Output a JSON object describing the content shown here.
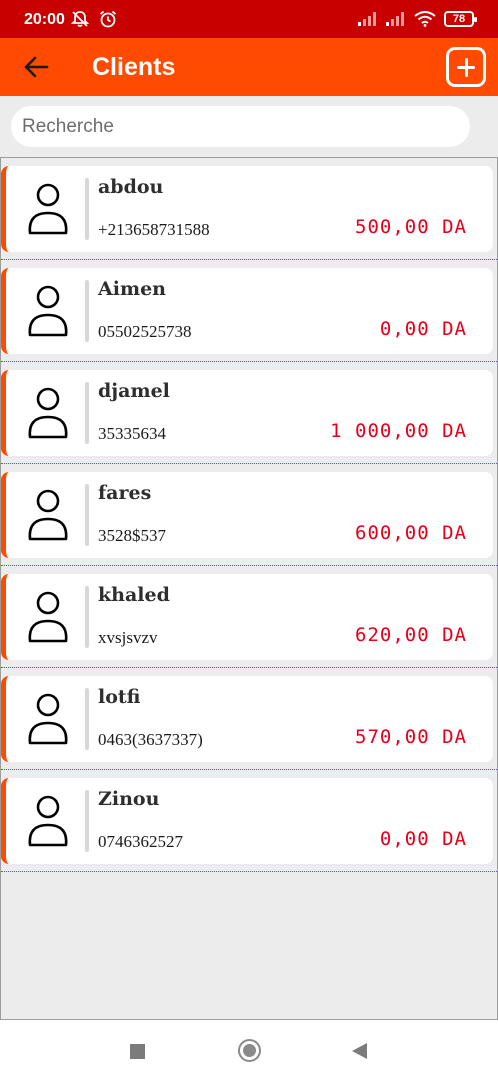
{
  "status_bar": {
    "time": "20:00",
    "battery": "78"
  },
  "app_bar": {
    "title": "Clients"
  },
  "search": {
    "placeholder": "Recherche",
    "value": ""
  },
  "clients": [
    {
      "name": "abdou",
      "phone": "+213658731588",
      "amount": "500,00 DA"
    },
    {
      "name": "Aimen",
      "phone": "05502525738",
      "amount": "0,00 DA"
    },
    {
      "name": "djamel",
      "phone": "35335634",
      "amount": "1 000,00 DA"
    },
    {
      "name": "fares",
      "phone": "3528$537",
      "amount": "600,00 DA"
    },
    {
      "name": "khaled",
      "phone": "xvsjsvzv",
      "amount": "620,00 DA"
    },
    {
      "name": "lotfi",
      "phone": "0463(3637337)",
      "amount": "570,00 DA"
    },
    {
      "name": "Zinou",
      "phone": "0746362527",
      "amount": "0,00 DA"
    }
  ],
  "colors": {
    "status_bar": "#c90000",
    "accent": "#ff4a00",
    "amount": "#e8001b",
    "separator": "#4a56ff"
  },
  "icons": [
    "back-arrow-icon",
    "add-icon",
    "user-avatar-icon",
    "nav-recents-icon",
    "nav-home-icon",
    "nav-back-icon"
  ]
}
